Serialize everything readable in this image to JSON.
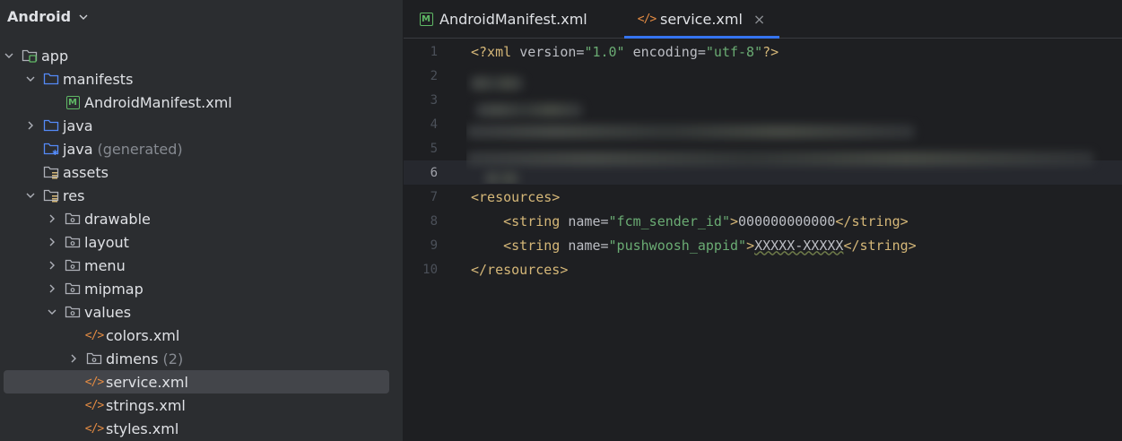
{
  "project_panel": {
    "title": "Android",
    "tree": [
      {
        "label": "app",
        "suffix": "",
        "arrow": "down",
        "icon": "module-folder-icon"
      },
      {
        "label": "manifests",
        "suffix": "",
        "arrow": "down",
        "icon": "folder-icon"
      },
      {
        "label": "AndroidManifest.xml",
        "suffix": "",
        "arrow": "none",
        "icon": "manifest-file-icon"
      },
      {
        "label": "java",
        "suffix": "",
        "arrow": "right",
        "icon": "folder-icon"
      },
      {
        "label": "java",
        "suffix": "(generated)",
        "arrow": "none",
        "icon": "generated-folder-icon"
      },
      {
        "label": "assets",
        "suffix": "",
        "arrow": "none",
        "icon": "resource-folder-icon"
      },
      {
        "label": "res",
        "suffix": "",
        "arrow": "down",
        "icon": "resource-folder-icon"
      },
      {
        "label": "drawable",
        "suffix": "",
        "arrow": "right",
        "icon": "package-folder-icon"
      },
      {
        "label": "layout",
        "suffix": "",
        "arrow": "right",
        "icon": "package-folder-icon"
      },
      {
        "label": "menu",
        "suffix": "",
        "arrow": "right",
        "icon": "package-folder-icon"
      },
      {
        "label": "mipmap",
        "suffix": "",
        "arrow": "right",
        "icon": "package-folder-icon"
      },
      {
        "label": "values",
        "suffix": "",
        "arrow": "down",
        "icon": "package-folder-icon"
      },
      {
        "label": "colors.xml",
        "suffix": "",
        "arrow": "none",
        "icon": "xml-file-icon"
      },
      {
        "label": "dimens",
        "suffix": "(2)",
        "arrow": "right",
        "icon": "package-folder-icon"
      },
      {
        "label": "service.xml",
        "suffix": "",
        "arrow": "none",
        "icon": "xml-file-icon",
        "selected": true
      },
      {
        "label": "strings.xml",
        "suffix": "",
        "arrow": "none",
        "icon": "xml-file-icon"
      },
      {
        "label": "styles.xml",
        "suffix": "",
        "arrow": "none",
        "icon": "xml-file-icon"
      }
    ]
  },
  "editor": {
    "tabs": [
      {
        "label": "AndroidManifest.xml",
        "icon": "manifest-file-icon",
        "active": false
      },
      {
        "label": "service.xml",
        "icon": "xml-file-icon",
        "active": true,
        "close": "×"
      }
    ],
    "line_numbers": [
      "1",
      "2",
      "3",
      "4",
      "5",
      "6",
      "7",
      "8",
      "9",
      "10"
    ],
    "current_line": "6",
    "code": {
      "line1": {
        "open": "<?xml ",
        "attr1": "version=",
        "val1": "\"1.0\"",
        "attr2": " encoding=",
        "val2": "\"utf-8\"",
        "close": "?>"
      },
      "line7": {
        "tag": "<resources>"
      },
      "line8": {
        "indent": "    ",
        "open": "<string ",
        "attr": "name=",
        "val": "\"fcm_sender_id\"",
        "gt": ">",
        "text": "000000000000",
        "close": "</string>"
      },
      "line9": {
        "indent": "    ",
        "open": "<string ",
        "attr": "name=",
        "val": "\"pushwoosh_appid\"",
        "gt": ">",
        "text": "XXXXX-XXXXX",
        "close": "</string>"
      },
      "line10": {
        "tag": "</resources>"
      }
    }
  },
  "colors": {
    "background": "#1e1f22",
    "panel": "#2b2d30",
    "selection": "#43454a",
    "accent": "#3574f0",
    "xml_tag": "#d5b778",
    "xml_value": "#6aab73",
    "xml_icon": "#e38b43",
    "manifest_icon": "#5fb865",
    "folder_icon": "#548af7"
  }
}
